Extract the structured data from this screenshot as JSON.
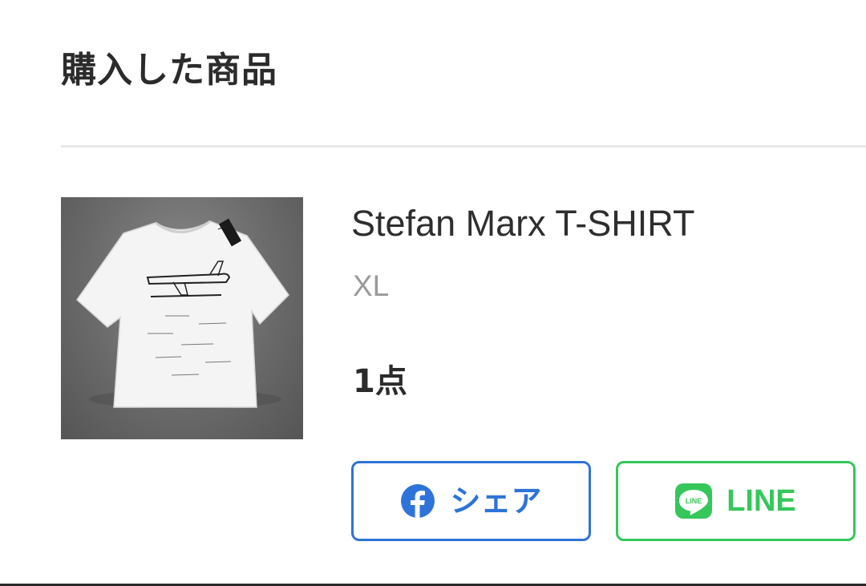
{
  "section": {
    "title": "購入した商品"
  },
  "product": {
    "name": "Stefan Marx T-SHIRT",
    "variant": "XL",
    "quantity": "1点",
    "image_icon": "t-shirt-photo"
  },
  "share": {
    "facebook": {
      "label": "シェア",
      "icon": "facebook-icon",
      "color": "#2e73d9"
    },
    "line": {
      "label": "LINE",
      "icon": "line-icon",
      "icon_text": "LINE",
      "color": "#35c75a"
    }
  }
}
